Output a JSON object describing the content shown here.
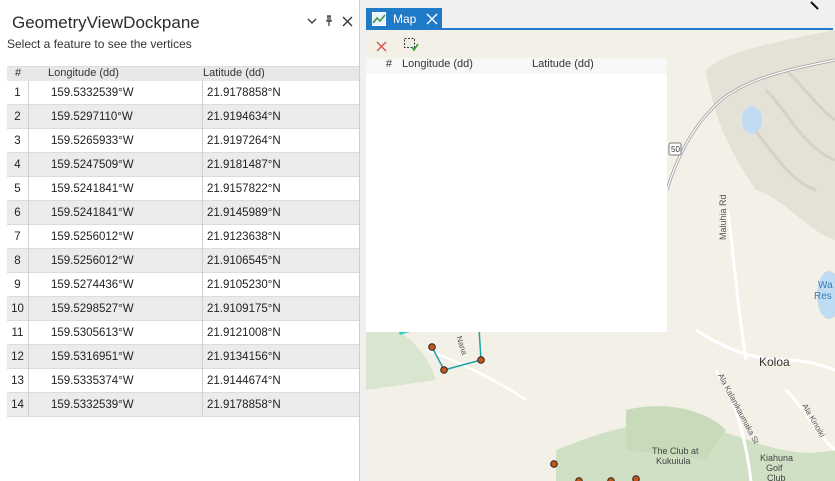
{
  "dockpane": {
    "title": "GeometryViewDockpane",
    "subtitle": "Select a feature to see the vertices",
    "controls": {
      "dropdown": "⌄",
      "pin": "⊥",
      "close": "✕"
    },
    "columns": {
      "num": "#",
      "lon": "Longitude (dd)",
      "lat": "Latitude (dd)"
    },
    "rows": [
      {
        "n": "1",
        "lon": "159.5332539°W",
        "lat": "21.9178858°N"
      },
      {
        "n": "2",
        "lon": "159.5297110°W",
        "lat": "21.9194634°N"
      },
      {
        "n": "3",
        "lon": "159.5265933°W",
        "lat": "21.9197264°N"
      },
      {
        "n": "4",
        "lon": "159.5247509°W",
        "lat": "21.9181487°N"
      },
      {
        "n": "5",
        "lon": "159.5241841°W",
        "lat": "21.9157822°N"
      },
      {
        "n": "6",
        "lon": "159.5241841°W",
        "lat": "21.9145989°N"
      },
      {
        "n": "7",
        "lon": "159.5256012°W",
        "lat": "21.9123638°N"
      },
      {
        "n": "8",
        "lon": "159.5256012°W",
        "lat": "21.9106545°N"
      },
      {
        "n": "9",
        "lon": "159.5274436°W",
        "lat": "21.9105230°N"
      },
      {
        "n": "10",
        "lon": "159.5298527°W",
        "lat": "21.9109175°N"
      },
      {
        "n": "11",
        "lon": "159.5305613°W",
        "lat": "21.9121008°N"
      },
      {
        "n": "12",
        "lon": "159.5316951°W",
        "lat": "21.9134156°N"
      },
      {
        "n": "13",
        "lon": "159.5335374°W",
        "lat": "21.9144674°N"
      },
      {
        "n": "14",
        "lon": "159.5332539°W",
        "lat": "21.9178858°N"
      }
    ]
  },
  "map": {
    "tab_label": "Map",
    "overlay_columns": {
      "num": "#",
      "lon": "Longitude (dd)",
      "lat": "Latitude (dd)"
    },
    "labels": {
      "route": "50",
      "road1": "Maluhia Rd",
      "town": "Koloa",
      "road2": "Ala Kalanikaumaka St",
      "road3": "Ala Kinoiki",
      "club": "The Club at",
      "club2": "Kukuiula",
      "kiahuna1": "Kiahuna",
      "kiahuna2": "Golf",
      "kiahuna3": "Club",
      "nana": "Nana",
      "edge1": "Wa",
      "edge2": "Res"
    }
  }
}
